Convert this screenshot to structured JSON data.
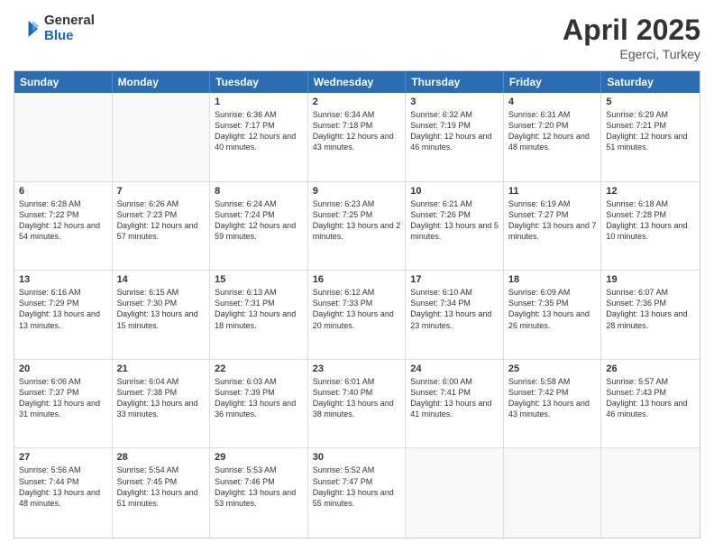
{
  "logo": {
    "general": "General",
    "blue": "Blue"
  },
  "title": {
    "month": "April 2025",
    "location": "Egerci, Turkey"
  },
  "header_days": [
    "Sunday",
    "Monday",
    "Tuesday",
    "Wednesday",
    "Thursday",
    "Friday",
    "Saturday"
  ],
  "weeks": [
    [
      {
        "day": "",
        "info": ""
      },
      {
        "day": "",
        "info": ""
      },
      {
        "day": "1",
        "info": "Sunrise: 6:36 AM\nSunset: 7:17 PM\nDaylight: 12 hours and 40 minutes."
      },
      {
        "day": "2",
        "info": "Sunrise: 6:34 AM\nSunset: 7:18 PM\nDaylight: 12 hours and 43 minutes."
      },
      {
        "day": "3",
        "info": "Sunrise: 6:32 AM\nSunset: 7:19 PM\nDaylight: 12 hours and 46 minutes."
      },
      {
        "day": "4",
        "info": "Sunrise: 6:31 AM\nSunset: 7:20 PM\nDaylight: 12 hours and 48 minutes."
      },
      {
        "day": "5",
        "info": "Sunrise: 6:29 AM\nSunset: 7:21 PM\nDaylight: 12 hours and 51 minutes."
      }
    ],
    [
      {
        "day": "6",
        "info": "Sunrise: 6:28 AM\nSunset: 7:22 PM\nDaylight: 12 hours and 54 minutes."
      },
      {
        "day": "7",
        "info": "Sunrise: 6:26 AM\nSunset: 7:23 PM\nDaylight: 12 hours and 57 minutes."
      },
      {
        "day": "8",
        "info": "Sunrise: 6:24 AM\nSunset: 7:24 PM\nDaylight: 12 hours and 59 minutes."
      },
      {
        "day": "9",
        "info": "Sunrise: 6:23 AM\nSunset: 7:25 PM\nDaylight: 13 hours and 2 minutes."
      },
      {
        "day": "10",
        "info": "Sunrise: 6:21 AM\nSunset: 7:26 PM\nDaylight: 13 hours and 5 minutes."
      },
      {
        "day": "11",
        "info": "Sunrise: 6:19 AM\nSunset: 7:27 PM\nDaylight: 13 hours and 7 minutes."
      },
      {
        "day": "12",
        "info": "Sunrise: 6:18 AM\nSunset: 7:28 PM\nDaylight: 13 hours and 10 minutes."
      }
    ],
    [
      {
        "day": "13",
        "info": "Sunrise: 6:16 AM\nSunset: 7:29 PM\nDaylight: 13 hours and 13 minutes."
      },
      {
        "day": "14",
        "info": "Sunrise: 6:15 AM\nSunset: 7:30 PM\nDaylight: 13 hours and 15 minutes."
      },
      {
        "day": "15",
        "info": "Sunrise: 6:13 AM\nSunset: 7:31 PM\nDaylight: 13 hours and 18 minutes."
      },
      {
        "day": "16",
        "info": "Sunrise: 6:12 AM\nSunset: 7:33 PM\nDaylight: 13 hours and 20 minutes."
      },
      {
        "day": "17",
        "info": "Sunrise: 6:10 AM\nSunset: 7:34 PM\nDaylight: 13 hours and 23 minutes."
      },
      {
        "day": "18",
        "info": "Sunrise: 6:09 AM\nSunset: 7:35 PM\nDaylight: 13 hours and 26 minutes."
      },
      {
        "day": "19",
        "info": "Sunrise: 6:07 AM\nSunset: 7:36 PM\nDaylight: 13 hours and 28 minutes."
      }
    ],
    [
      {
        "day": "20",
        "info": "Sunrise: 6:06 AM\nSunset: 7:37 PM\nDaylight: 13 hours and 31 minutes."
      },
      {
        "day": "21",
        "info": "Sunrise: 6:04 AM\nSunset: 7:38 PM\nDaylight: 13 hours and 33 minutes."
      },
      {
        "day": "22",
        "info": "Sunrise: 6:03 AM\nSunset: 7:39 PM\nDaylight: 13 hours and 36 minutes."
      },
      {
        "day": "23",
        "info": "Sunrise: 6:01 AM\nSunset: 7:40 PM\nDaylight: 13 hours and 38 minutes."
      },
      {
        "day": "24",
        "info": "Sunrise: 6:00 AM\nSunset: 7:41 PM\nDaylight: 13 hours and 41 minutes."
      },
      {
        "day": "25",
        "info": "Sunrise: 5:58 AM\nSunset: 7:42 PM\nDaylight: 13 hours and 43 minutes."
      },
      {
        "day": "26",
        "info": "Sunrise: 5:57 AM\nSunset: 7:43 PM\nDaylight: 13 hours and 46 minutes."
      }
    ],
    [
      {
        "day": "27",
        "info": "Sunrise: 5:56 AM\nSunset: 7:44 PM\nDaylight: 13 hours and 48 minutes."
      },
      {
        "day": "28",
        "info": "Sunrise: 5:54 AM\nSunset: 7:45 PM\nDaylight: 13 hours and 51 minutes."
      },
      {
        "day": "29",
        "info": "Sunrise: 5:53 AM\nSunset: 7:46 PM\nDaylight: 13 hours and 53 minutes."
      },
      {
        "day": "30",
        "info": "Sunrise: 5:52 AM\nSunset: 7:47 PM\nDaylight: 13 hours and 55 minutes."
      },
      {
        "day": "",
        "info": ""
      },
      {
        "day": "",
        "info": ""
      },
      {
        "day": "",
        "info": ""
      }
    ]
  ]
}
